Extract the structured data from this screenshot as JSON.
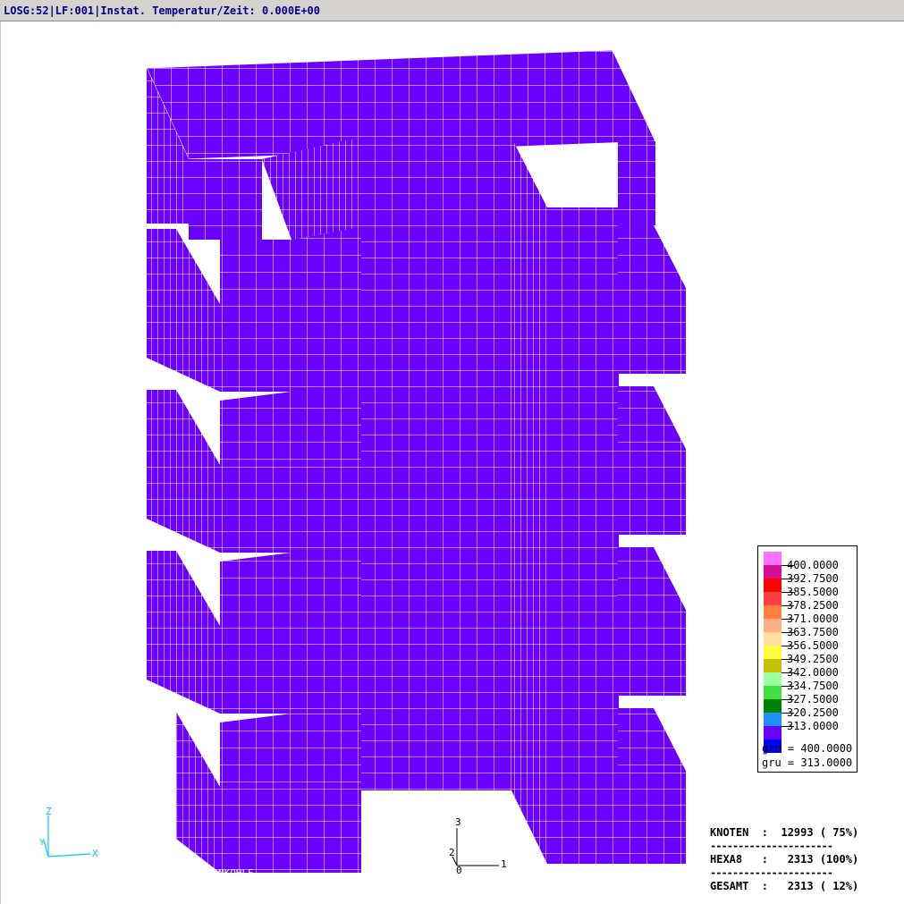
{
  "window": {
    "title": "LOSG:52|LF:001|Instat. Temperatur/Zeit: 0.000E+00"
  },
  "model": {
    "fill_color": "#6a00ff",
    "mesh_color": "#ffffff",
    "label": "NKOHLE"
  },
  "triad_left": {
    "z": "Z",
    "y": "Y",
    "x": "X",
    "color": "#00c8ff"
  },
  "triad_center": {
    "axis3": "3",
    "axis2": "2",
    "axis1": "1",
    "origin": "0"
  },
  "legend": {
    "entries": [
      {
        "color": "#ff70ff",
        "value": "400.0000"
      },
      {
        "color": "#d01090",
        "value": "392.7500"
      },
      {
        "color": "#ff0000",
        "value": "385.5000"
      },
      {
        "color": "#ff4040",
        "value": "378.2500"
      },
      {
        "color": "#ff8040",
        "value": "371.0000"
      },
      {
        "color": "#ffb080",
        "value": "363.7500"
      },
      {
        "color": "#ffe0a0",
        "value": "356.5000"
      },
      {
        "color": "#ffff40",
        "value": "349.2500"
      },
      {
        "color": "#c8c000",
        "value": "342.0000"
      },
      {
        "color": "#a0ffa0",
        "value": "334.7500"
      },
      {
        "color": "#40e040",
        "value": "327.5000"
      },
      {
        "color": "#008000",
        "value": "320.2500"
      },
      {
        "color": "#2090ff",
        "value": "313.0000"
      },
      {
        "color": "#6a00ff",
        "value": ""
      },
      {
        "color": "#0000ff",
        "value": ""
      }
    ],
    "gro": "gro = 400.0000",
    "gru": "gru = 313.0000"
  },
  "stats": {
    "knoten": "KNOTEN  :  12993 ( 75%)",
    "sep1": "----------------------",
    "hexa8": "HEXA8   :   2313 (100%)",
    "sep2": "----------------------",
    "gesamt": "GESAMT  :   2313 ( 12%)"
  }
}
